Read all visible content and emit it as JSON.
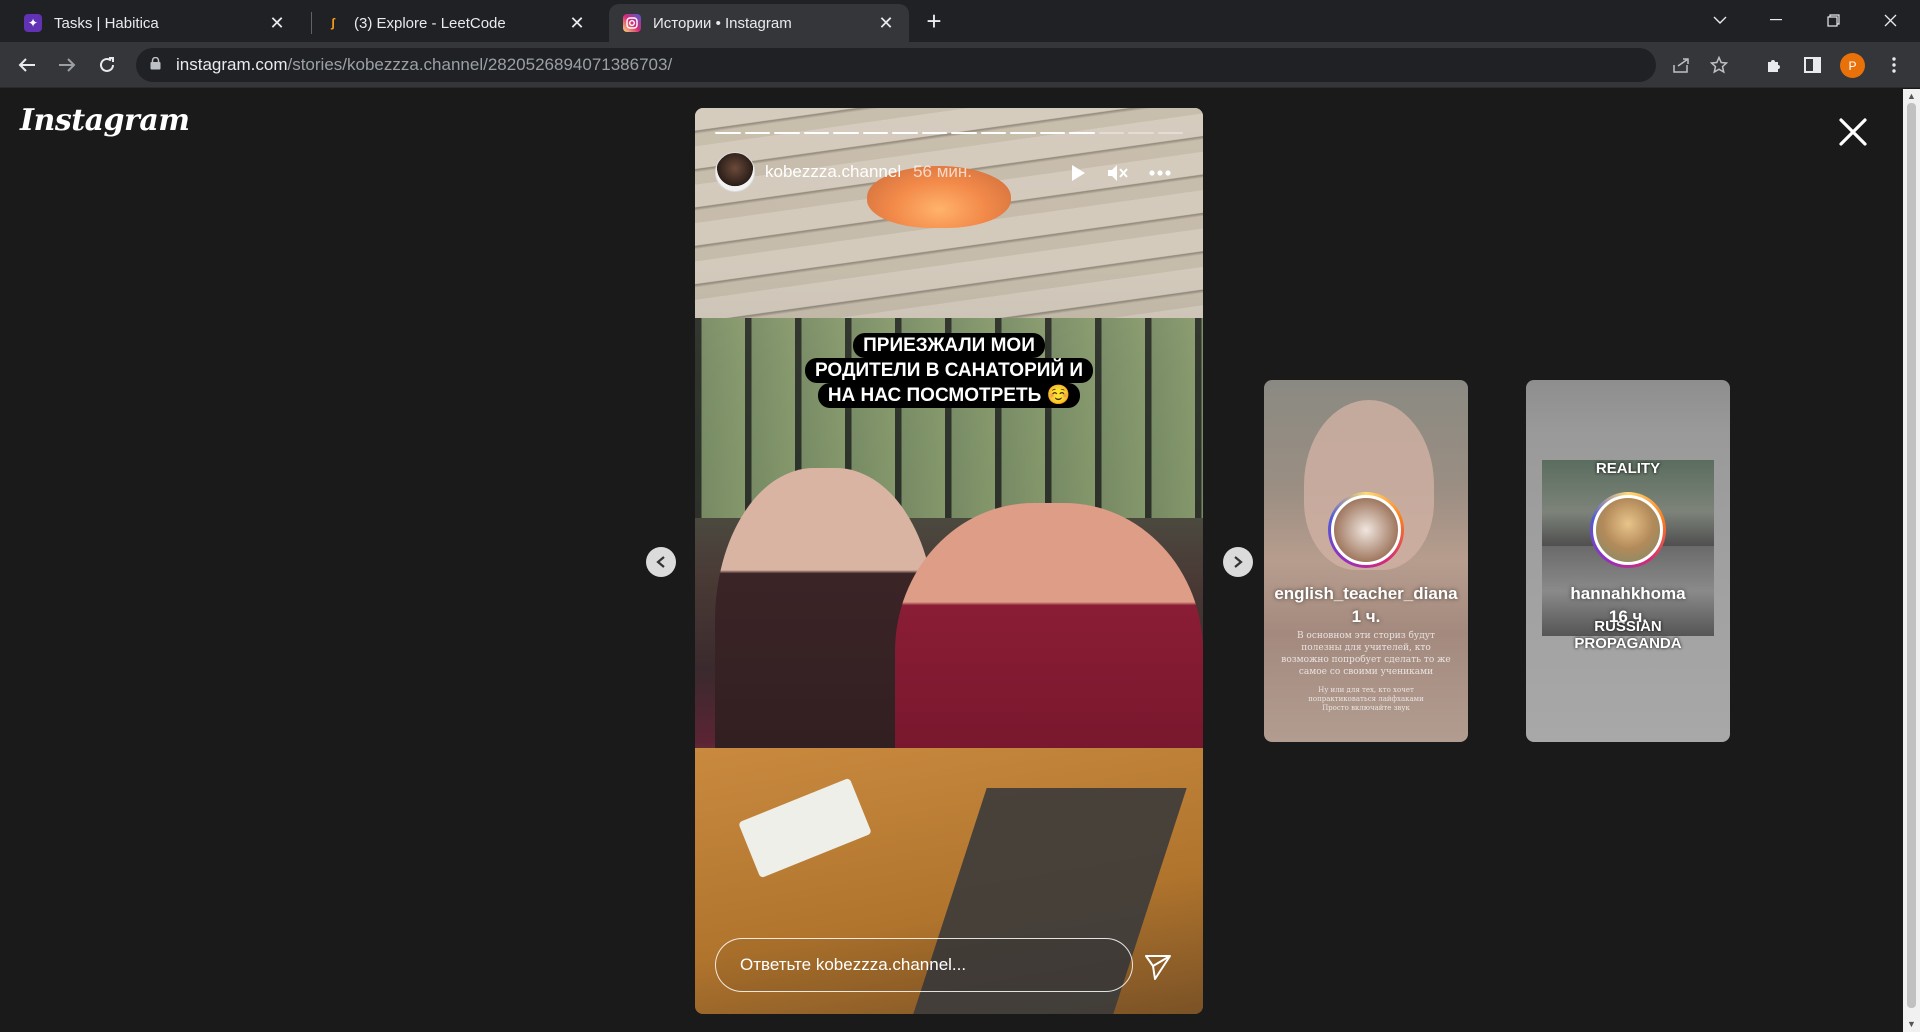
{
  "browser": {
    "tabs": [
      {
        "title": "Tasks | Habitica",
        "icon": "habitica-icon",
        "active": false
      },
      {
        "title": "(3) Explore - LeetCode",
        "icon": "leetcode-icon",
        "active": false
      },
      {
        "title": "Истории • Instagram",
        "icon": "instagram-icon",
        "active": true
      }
    ],
    "url_host": "instagram.com",
    "url_path": "/stories/kobezzza.channel/2820526894071386703/",
    "profile_initial": "P",
    "profile_color": "#e8710a"
  },
  "page": {
    "logo_text": "Instagram",
    "story": {
      "username": "kobezzza.channel",
      "time": "56 мин.",
      "caption_lines": [
        "ПРИЕЗЖАЛИ МОИ",
        "РОДИТЕЛИ В САНАТОРИЙ И",
        "НА НАС ПОСМОТРЕТЬ ☺️"
      ],
      "reply_placeholder": "Ответьте kobezzza.channel...",
      "progress_total": 16,
      "progress_done": 13
    },
    "previews": [
      {
        "username": "english_teacher_diana",
        "time": "1 ч.",
        "text_lines": [
          "В основном эти сториз будут",
          "полезны для учителей, кто",
          "возможно попробует сделать то же",
          "самое со своими учениками",
          "",
          "Ну или для тех, кто хочет",
          "попрактиковаться лайфхаками",
          "Просто включайте звук"
        ]
      },
      {
        "username": "hannahkhoma",
        "time": "16 ч.",
        "caption_top": "REALITY",
        "caption_bottom": "RUSSIAN PROPAGANDA"
      }
    ]
  }
}
